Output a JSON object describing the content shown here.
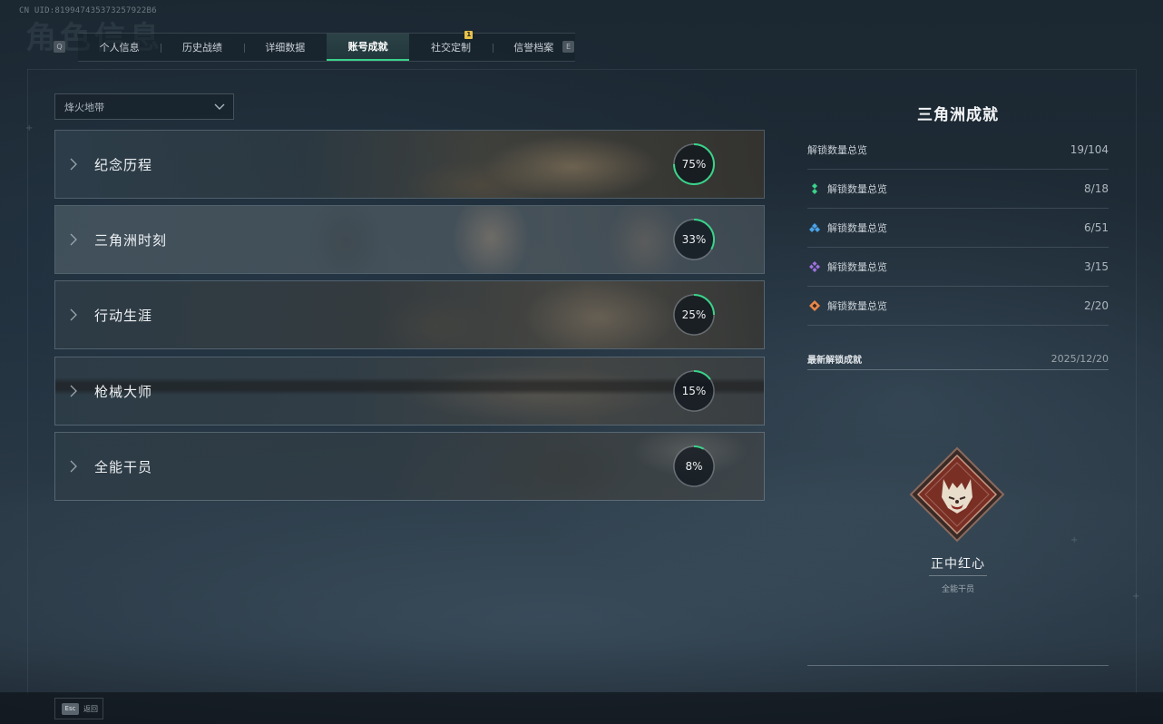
{
  "header": {
    "uid": "CN UID:819947435373257922B6",
    "ghost_title": "角色信息"
  },
  "key_hints": {
    "left": "Q",
    "right": "E"
  },
  "tabs": [
    {
      "label": "个人信息",
      "active": false
    },
    {
      "label": "历史战绩",
      "active": false
    },
    {
      "label": "详细数据",
      "active": false
    },
    {
      "label": "账号成就",
      "active": true
    },
    {
      "label": "社交定制",
      "active": false,
      "badge": "1"
    },
    {
      "label": "信誉档案",
      "active": false
    }
  ],
  "mode_select": {
    "value": "烽火地带"
  },
  "categories": [
    {
      "label": "纪念历程",
      "percent_text": "75%",
      "progress": 0.75
    },
    {
      "label": "三角洲时刻",
      "percent_text": "33%",
      "progress": 0.33
    },
    {
      "label": "行动生涯",
      "percent_text": "25%",
      "progress": 0.25
    },
    {
      "label": "枪械大师",
      "percent_text": "15%",
      "progress": 0.15
    },
    {
      "label": "全能干员",
      "percent_text": "8%",
      "progress": 0.08
    }
  ],
  "summary": {
    "title": "三角洲成就",
    "rows": [
      {
        "label": "解锁数量总览",
        "value": "19/104",
        "icon": "none"
      },
      {
        "label": "解锁数量总览",
        "value": "8/18",
        "icon": "green-tier-icon",
        "color": "#3ad38a"
      },
      {
        "label": "解锁数量总览",
        "value": "6/51",
        "icon": "blue-tier-icon",
        "color": "#4aa3e8"
      },
      {
        "label": "解锁数量总览",
        "value": "3/15",
        "icon": "purple-tier-icon",
        "color": "#a070e0"
      },
      {
        "label": "解锁数量总览",
        "value": "2/20",
        "icon": "orange-tier-icon",
        "color": "#e8874a"
      }
    ]
  },
  "latest": {
    "label": "最新解锁成就",
    "date": "2025/12/20",
    "achievement_name": "正中红心",
    "achievement_category": "全能干员",
    "badge_icon": "wolf-emblem-icon"
  },
  "footer": {
    "key": "Esc",
    "label": "返回"
  },
  "colors": {
    "accent": "#3ad38a",
    "badge": "#e7c24a",
    "emblem": "#7a2f25"
  }
}
